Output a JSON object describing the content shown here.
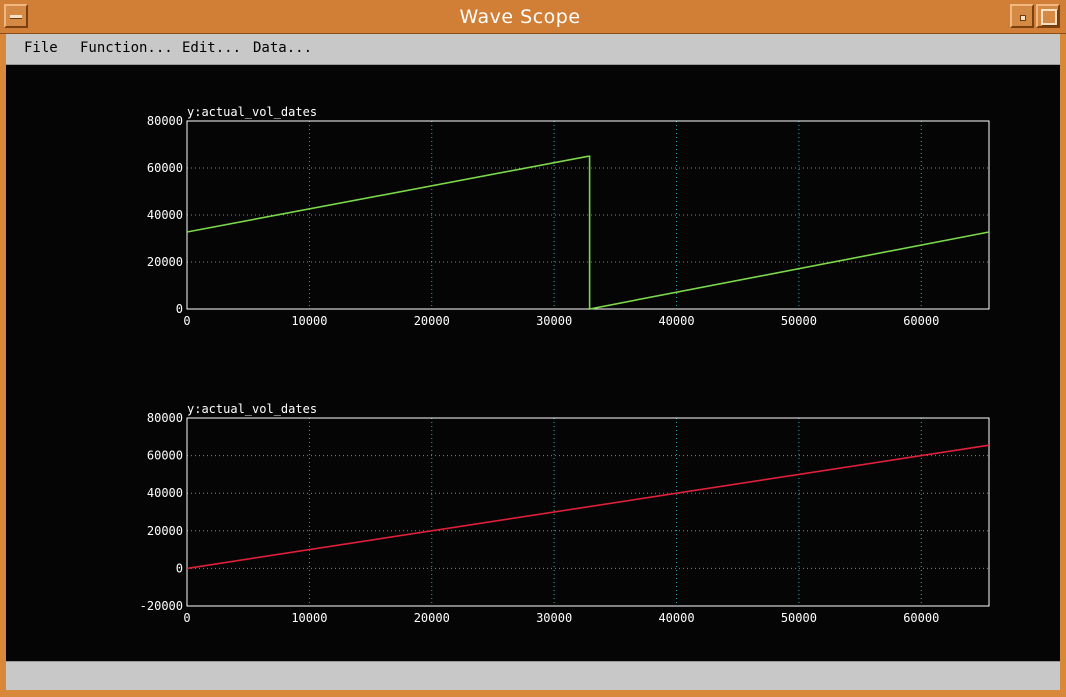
{
  "window": {
    "title": "Wave Scope"
  },
  "menu": {
    "file": "File",
    "function": "Function...",
    "edit": "Edit...",
    "data": "Data..."
  },
  "colors": {
    "background": "#050505",
    "grid": "#20b0c0",
    "frame": "#ffffff",
    "series_top": "#7cd84a",
    "series_bottom": "#e0203a"
  },
  "chart_data": [
    {
      "type": "line",
      "title": "y:actual_vol_dates",
      "xlim": [
        0,
        65535
      ],
      "ylim": [
        0,
        80000
      ],
      "xticks": [
        0,
        10000,
        20000,
        30000,
        40000,
        50000,
        60000
      ],
      "yticks": [
        0,
        20000,
        40000,
        60000,
        80000
      ],
      "grid": true,
      "series": [
        {
          "color": "#7cd84a",
          "x": [
            0,
            32767,
            32768,
            32900,
            32900,
            65535
          ],
          "y": [
            32767,
            65000,
            65000,
            65000,
            0,
            32767
          ]
        }
      ]
    },
    {
      "type": "line",
      "title": "y:actual_vol_dates",
      "xlim": [
        0,
        65535
      ],
      "ylim": [
        -20000,
        80000
      ],
      "xticks": [
        0,
        10000,
        20000,
        30000,
        40000,
        50000,
        60000
      ],
      "yticks": [
        -20000,
        0,
        20000,
        40000,
        60000,
        80000
      ],
      "grid": true,
      "series": [
        {
          "color": "#e0203a",
          "x": [
            0,
            65535
          ],
          "y": [
            0,
            65535
          ]
        }
      ]
    }
  ]
}
